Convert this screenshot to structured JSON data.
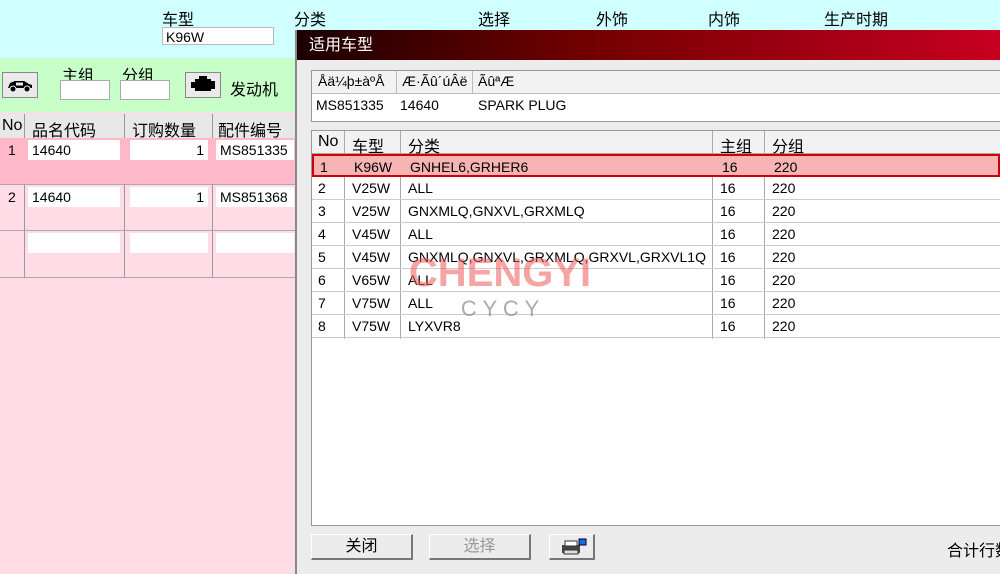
{
  "header": {
    "labels": [
      "车型",
      "分类",
      "选择",
      "外饰",
      "内饰",
      "生产时期"
    ],
    "vehicle_value": "K96W"
  },
  "left_panel": {
    "toolbar": {
      "main_group_label": "主组",
      "sub_group_label": "分组",
      "engine_label": "发动机"
    },
    "columns": [
      "No",
      "品名代码",
      "订购数量",
      "配件编号"
    ],
    "rows": [
      {
        "no": "1",
        "code": "14640",
        "qty": "1",
        "part": "MS851335"
      },
      {
        "no": "2",
        "code": "14640",
        "qty": "1",
        "part": "MS851368"
      }
    ]
  },
  "dialog": {
    "title": "适用车型",
    "info_headers": [
      "Åä¼þ±àºÅ",
      "Æ·Ãû´úÂë",
      "ÃûªÆ"
    ],
    "info_values": [
      "MS851335",
      "14640",
      "SPARK PLUG"
    ],
    "columns": [
      "No",
      "车型",
      "分类",
      "主组",
      "分组"
    ],
    "rows": [
      {
        "no": "1",
        "model": "K96W",
        "category": "GNHEL6,GRHER6",
        "main": "16",
        "sub": "220"
      },
      {
        "no": "2",
        "model": "V25W",
        "category": "ALL",
        "main": "16",
        "sub": "220"
      },
      {
        "no": "3",
        "model": "V25W",
        "category": "GNXMLQ,GNXVL,GRXMLQ",
        "main": "16",
        "sub": "220"
      },
      {
        "no": "4",
        "model": "V45W",
        "category": "ALL",
        "main": "16",
        "sub": "220"
      },
      {
        "no": "5",
        "model": "V45W",
        "category": "GNXMLQ,GNXVL,GRXMLQ,GRXVL,GRXVL1Q",
        "main": "16",
        "sub": "220"
      },
      {
        "no": "6",
        "model": "V65W",
        "category": "ALL",
        "main": "16",
        "sub": "220"
      },
      {
        "no": "7",
        "model": "V75W",
        "category": "ALL",
        "main": "16",
        "sub": "220"
      },
      {
        "no": "8",
        "model": "V75W",
        "category": "LYXVR8",
        "main": "16",
        "sub": "220"
      }
    ],
    "selected_row": 0,
    "buttons": {
      "close": "关闭",
      "select": "选择"
    },
    "total_label": "合计行数"
  },
  "watermark": {
    "line1": "CHENGYI",
    "line2": "C Y C Y"
  },
  "icons": {
    "car": "car-icon",
    "engine": "engine-icon",
    "print": "printer-icon"
  },
  "colors": {
    "title_bar": "#c80020",
    "selected_row": "#f8b4b4",
    "toolbar_bg": "#c8ffc8",
    "header_bg": "#cfffff",
    "body_bg": "#ffdce6"
  }
}
